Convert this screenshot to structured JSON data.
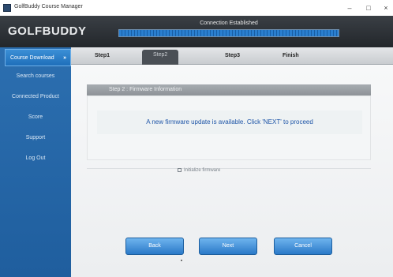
{
  "window": {
    "title": "GolfBuddy Course Manager",
    "minimize": "–",
    "maximize": "□",
    "close": "×"
  },
  "header": {
    "logo": "GOLFBUDDY",
    "connection_status": "Connection Established",
    "connection_progress": 1.0
  },
  "sidebar": {
    "items": [
      {
        "label": "Course Download",
        "active": true,
        "arrow": "»"
      },
      {
        "label": "Search courses",
        "active": false
      },
      {
        "label": "Connected Product",
        "active": false
      },
      {
        "label": "Score",
        "active": false
      },
      {
        "label": "Support",
        "active": false
      },
      {
        "label": "Log Out",
        "active": false
      }
    ]
  },
  "steps": [
    {
      "label": "Step1",
      "active": false
    },
    {
      "label": "Step2",
      "active": true
    },
    {
      "label": "Step3",
      "active": false
    },
    {
      "label": "Finish",
      "active": false
    }
  ],
  "panel": {
    "title": "Step 2 : Firmware Information",
    "message": "A new firmware update is available. Click 'NEXT' to proceed",
    "option_label": "Initialize firmware"
  },
  "buttons": {
    "back": "Back",
    "next": "Next",
    "cancel": "Cancel"
  },
  "colors": {
    "sidebar": "#1f5e9e",
    "header": "#2c3035",
    "accent": "#2a79c8",
    "message_text": "#1f56a8"
  }
}
